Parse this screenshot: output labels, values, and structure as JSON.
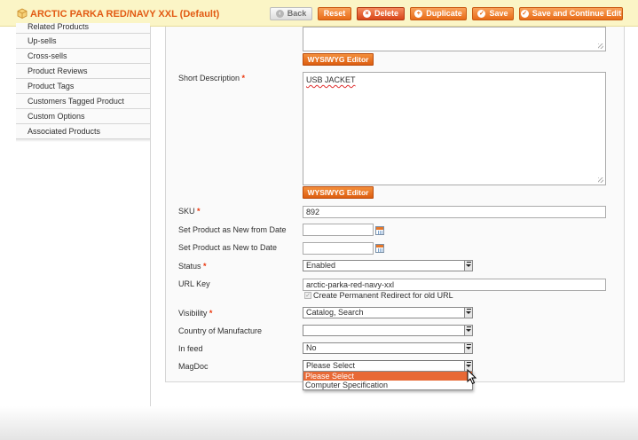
{
  "header": {
    "title": "ARCTIC PARKA RED/NAVY XXL (Default)",
    "buttons": {
      "back": "Back",
      "reset": "Reset",
      "delete": "Delete",
      "duplicate": "Duplicate",
      "save": "Save",
      "save_continue": "Save and Continue Edit"
    }
  },
  "sidebar": {
    "items": [
      {
        "label": "Related Products"
      },
      {
        "label": "Up-sells"
      },
      {
        "label": "Cross-sells"
      },
      {
        "label": "Product Reviews"
      },
      {
        "label": "Product Tags"
      },
      {
        "label": "Customers Tagged Product"
      },
      {
        "label": "Custom Options"
      },
      {
        "label": "Associated Products"
      }
    ]
  },
  "form": {
    "wysiwyg_label": "WYSIWYG Editor",
    "short_description": {
      "label": "Short Description",
      "value": "USB JACKET"
    },
    "sku": {
      "label": "SKU",
      "value": "892"
    },
    "new_from": {
      "label": "Set Product as New from Date",
      "value": ""
    },
    "new_to": {
      "label": "Set Product as New to Date",
      "value": ""
    },
    "status": {
      "label": "Status",
      "value": "Enabled"
    },
    "url_key": {
      "label": "URL Key",
      "value": "arctic-parka-red-navy-xxl",
      "redirect_label": "Create Permanent Redirect for old URL",
      "redirect_checked": true
    },
    "visibility": {
      "label": "Visibility",
      "value": "Catalog, Search"
    },
    "country": {
      "label": "Country of Manufacture",
      "value": ""
    },
    "in_feed": {
      "label": "In feed",
      "value": "No"
    },
    "magdoc": {
      "label": "MagDoc",
      "value": "Please Select",
      "options": [
        "Please Select",
        "Computer Specification"
      ]
    },
    "required_mark": "*"
  },
  "colors": {
    "accent": "#e86b18",
    "title": "#e25a13",
    "required": "#eb340a"
  },
  "icons": {
    "product": "product-box-icon",
    "calendar": "calendar-icon",
    "cursor": "mouse-pointer-icon"
  }
}
